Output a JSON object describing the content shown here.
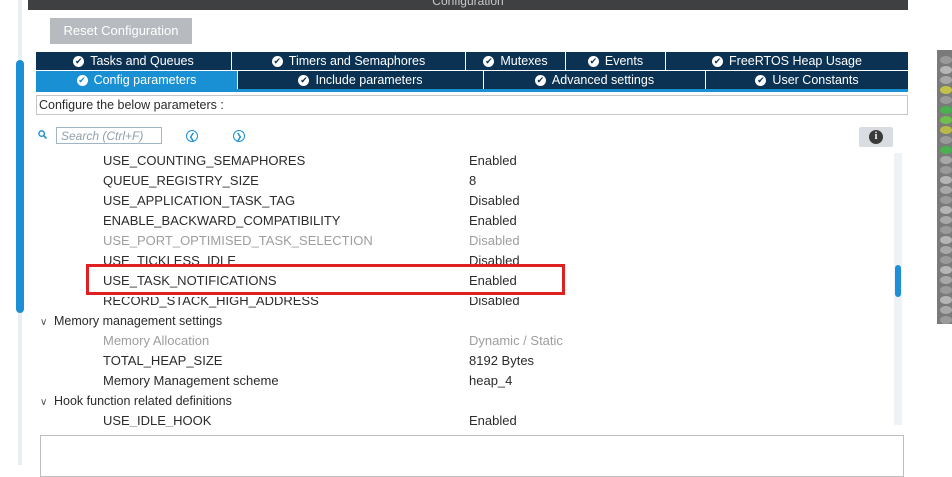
{
  "window": {
    "title": "Configuration"
  },
  "toolbar": {
    "reset_label": "Reset Configuration"
  },
  "tabs_row1": [
    {
      "label": "Tasks and Queues",
      "width": 196
    },
    {
      "label": "Timers and Semaphores",
      "width": 234
    },
    {
      "label": "Mutexes",
      "width": 100
    },
    {
      "label": "Events",
      "width": 100
    },
    {
      "label": "FreeRTOS Heap Usage",
      "width": 242
    }
  ],
  "tabs_row2": [
    {
      "label": "Config parameters",
      "active": true,
      "width": 202
    },
    {
      "label": "Include parameters",
      "width": 246
    },
    {
      "label": "Advanced settings",
      "width": 222
    },
    {
      "label": "User Constants",
      "width": 202
    }
  ],
  "config_hint": "Configure the below parameters :",
  "search": {
    "placeholder": "Search (Ctrl+F)"
  },
  "params": [
    {
      "name": "USE_COUNTING_SEMAPHORES",
      "value": "Enabled"
    },
    {
      "name": "QUEUE_REGISTRY_SIZE",
      "value": "8"
    },
    {
      "name": "USE_APPLICATION_TASK_TAG",
      "value": "Disabled"
    },
    {
      "name": "ENABLE_BACKWARD_COMPATIBILITY",
      "value": "Enabled"
    },
    {
      "name": "USE_PORT_OPTIMISED_TASK_SELECTION",
      "value": "Disabled",
      "grey": true
    },
    {
      "name": "USE_TICKLESS_IDLE",
      "value": "Disabled"
    },
    {
      "name": "USE_TASK_NOTIFICATIONS",
      "value": "Enabled"
    },
    {
      "name": "RECORD_STACK_HIGH_ADDRESS",
      "value": "Disabled"
    }
  ],
  "memory_section": {
    "label": "Memory management settings"
  },
  "memory_params": [
    {
      "name": "Memory Allocation",
      "value": "Dynamic / Static",
      "grey": true
    },
    {
      "name": "TOTAL_HEAP_SIZE",
      "value": "8192 Bytes"
    },
    {
      "name": "Memory Management scheme",
      "value": "heap_4"
    }
  ],
  "hook_section": {
    "label": "Hook function related definitions"
  },
  "hook_params": [
    {
      "name": "USE_IDLE_HOOK",
      "value": "Enabled"
    }
  ],
  "colors": {
    "tab_bg": "#0b3253",
    "tab_active": "#1a90d4",
    "highlight": "#e02020",
    "accent": "#1d8fd6"
  },
  "icons": {
    "tab_check": "check-circle-icon",
    "search": "search-icon",
    "prev": "chevron-left-circle-icon",
    "next": "chevron-right-circle-icon",
    "info": "info-icon",
    "expand": "chevron-down-icon"
  }
}
